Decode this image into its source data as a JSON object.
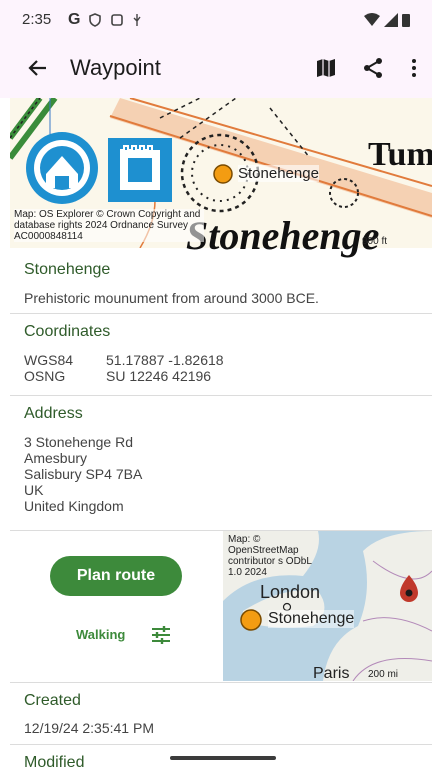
{
  "status": {
    "time": "2:35",
    "left_icons": [
      "google-icon",
      "vpn-icon",
      "screen-icon",
      "usb-icon"
    ],
    "right_icons": [
      "wifi-icon",
      "signal-icon",
      "battery-icon"
    ]
  },
  "appbar": {
    "title": "Waypoint",
    "actions": [
      "map-icon",
      "share-icon",
      "more-vert-icon"
    ]
  },
  "map": {
    "label": "Stonehenge",
    "big_label": "Stonehenge",
    "partial_label": "Tum",
    "attribution": "Map: OS Explorer © Crown Copyright and database rights 2024 Ordnance Survey AC0000848114",
    "scale": "900 ft"
  },
  "waypoint": {
    "name": "Stonehenge",
    "description": "Prehistoric mounument from around 3000 BCE."
  },
  "coordinates": {
    "heading": "Coordinates",
    "rows": [
      {
        "label": "WGS84",
        "value": "51.17887  -1.82618"
      },
      {
        "label": "OSNG",
        "value": "SU 12246 42196"
      }
    ]
  },
  "address": {
    "heading": "Address",
    "lines": [
      "3 Stonehenge Rd",
      "Amesbury",
      "Salisbury SP4 7BA",
      "UK",
      "United Kingdom"
    ]
  },
  "route": {
    "button": "Plan route",
    "mode": "Walking"
  },
  "minimap": {
    "attribution": "Map: © OpenStreetMap contributor s ODbL 1.0 2024",
    "city1": "London",
    "city2": "Paris",
    "label": "Stonehenge",
    "scale": "200 mi"
  },
  "created": {
    "heading": "Created",
    "value": "12/19/24 2:35:41 PM"
  },
  "modified": {
    "heading": "Modified"
  },
  "colors": {
    "accent": "#3d8a3b",
    "heading": "#2f5b2a",
    "bar": "#fdf4fd",
    "marker": "#f39c12"
  }
}
